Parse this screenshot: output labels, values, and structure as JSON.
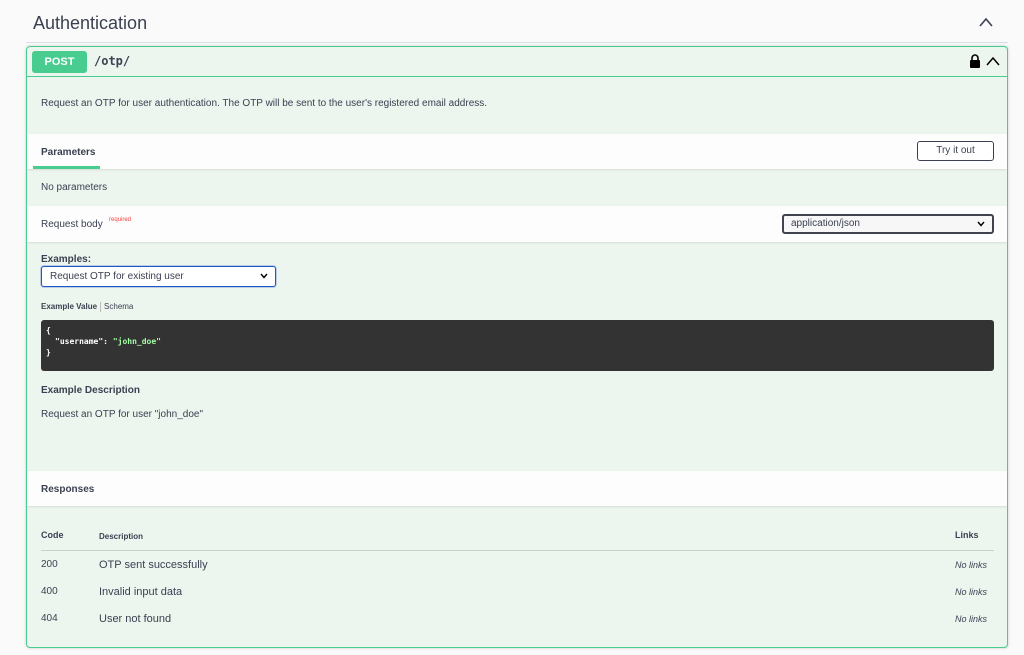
{
  "tag": {
    "title": "Authentication"
  },
  "operation": {
    "method": "POST",
    "path": "/otp/",
    "description": "Request an OTP for user authentication. The OTP will be sent to the user's registered email address.",
    "method_color": "#49cc90"
  },
  "parameters": {
    "tab_label": "Parameters",
    "try_it_out_label": "Try it out",
    "empty_text": "No parameters"
  },
  "request_body": {
    "label": "Request body",
    "required_label": "required",
    "content_type": "application/json",
    "examples_label": "Examples:",
    "selected_example": "Request OTP for existing user",
    "tab_example_value": "Example Value",
    "tab_schema": "Schema",
    "code": {
      "open": "{",
      "key": "\"username\"",
      "sep": ": ",
      "value": "\"john_doe\"",
      "close": "}"
    },
    "example_description_title": "Example Description",
    "example_description": "Request an OTP for user \"john_doe\""
  },
  "responses": {
    "title": "Responses",
    "headers": {
      "code": "Code",
      "description": "Description",
      "links": "Links"
    },
    "rows": [
      {
        "code": "200",
        "description": "OTP sent successfully",
        "links": "No links"
      },
      {
        "code": "400",
        "description": "Invalid input data",
        "links": "No links"
      },
      {
        "code": "404",
        "description": "User not found",
        "links": "No links"
      }
    ]
  }
}
